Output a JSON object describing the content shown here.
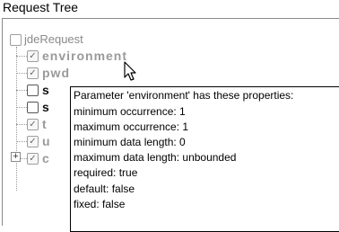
{
  "panel": {
    "title": "Request Tree"
  },
  "tree": {
    "root": {
      "label": "jdeRequest",
      "checked": false
    },
    "children": [
      {
        "label": "environment",
        "checked": true,
        "active": false
      },
      {
        "label": "pwd",
        "checked": true,
        "active": false
      },
      {
        "label": "s",
        "checked": false,
        "active": true
      },
      {
        "label": "s",
        "checked": false,
        "active": true
      },
      {
        "label": "t",
        "checked": true,
        "active": false
      },
      {
        "label": "u",
        "checked": true,
        "active": false
      },
      {
        "label": "c",
        "checked": true,
        "active": false
      }
    ],
    "expander_symbol": "+",
    "check_mark": "✓"
  },
  "tooltip": {
    "lines": [
      "Parameter 'environment' has these properties:",
      "minimum occurrence: 1",
      "maximum occurrence: 1",
      "minimum data length: 0",
      "maximum data length: unbounded",
      "required: true",
      "default: false",
      "fixed: false"
    ]
  },
  "icons": {
    "cursor": "mouse-pointer-icon",
    "expander": "expand-plus-icon"
  }
}
